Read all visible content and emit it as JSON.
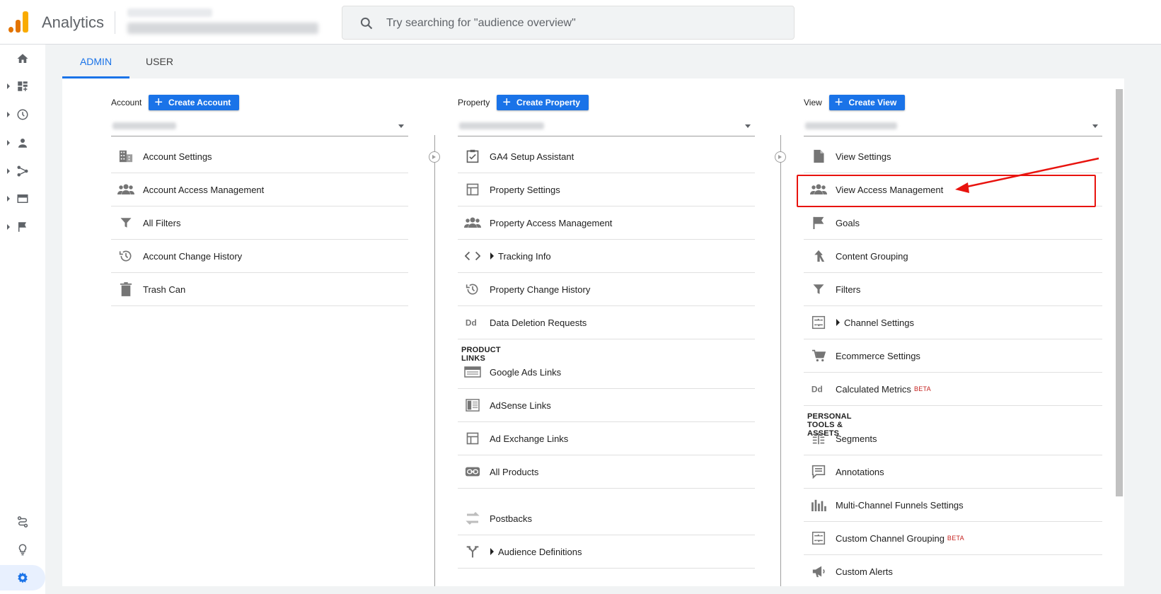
{
  "app": {
    "title": "Analytics"
  },
  "search": {
    "placeholder": "Try searching for \"audience overview\""
  },
  "tabs": [
    {
      "label": "ADMIN"
    },
    {
      "label": "USER"
    }
  ],
  "account": {
    "label": "Account",
    "create_label": "Create Account",
    "items": [
      {
        "label": "Account Settings",
        "icon": "building-icon"
      },
      {
        "label": "Account Access Management",
        "icon": "people-icon"
      },
      {
        "label": "All Filters",
        "icon": "filter-icon"
      },
      {
        "label": "Account Change History",
        "icon": "history-icon"
      },
      {
        "label": "Trash Can",
        "icon": "trash-icon"
      }
    ]
  },
  "property": {
    "label": "Property",
    "create_label": "Create Property",
    "items": [
      {
        "label": "GA4 Setup Assistant",
        "icon": "clipboard-check-icon"
      },
      {
        "label": "Property Settings",
        "icon": "layout-icon"
      },
      {
        "label": "Property Access Management",
        "icon": "people-icon"
      },
      {
        "label": "Tracking Info",
        "icon": "code-icon"
      },
      {
        "label": "Property Change History",
        "icon": "history-icon"
      },
      {
        "label": "Data Deletion Requests",
        "icon": "dd-icon"
      }
    ],
    "section_title": "PRODUCT LINKS",
    "links": [
      {
        "label": "Google Ads Links",
        "icon": "ads-icon"
      },
      {
        "label": "AdSense Links",
        "icon": "adsense-icon"
      },
      {
        "label": "Ad Exchange Links",
        "icon": "layout-icon"
      },
      {
        "label": "All Products",
        "icon": "link-icon"
      },
      {
        "label": "Postbacks",
        "icon": "postbacks-icon"
      },
      {
        "label": "Audience Definitions",
        "icon": "fork-icon"
      }
    ]
  },
  "view": {
    "label": "View",
    "create_label": "Create View",
    "items": [
      {
        "label": "View Settings",
        "icon": "document-icon"
      },
      {
        "label": "View Access Management",
        "icon": "people-icon"
      },
      {
        "label": "Goals",
        "icon": "flag-icon"
      },
      {
        "label": "Content Grouping",
        "icon": "grouping-icon"
      },
      {
        "label": "Filters",
        "icon": "filter-icon"
      },
      {
        "label": "Channel Settings",
        "icon": "channel-icon"
      },
      {
        "label": "Ecommerce Settings",
        "icon": "cart-icon"
      },
      {
        "label": "Calculated Metrics",
        "icon": "dd-icon",
        "badge": "BETA"
      }
    ],
    "section_title": "PERSONAL TOOLS & ASSETS",
    "tools": [
      {
        "label": "Segments",
        "icon": "segments-icon"
      },
      {
        "label": "Annotations",
        "icon": "annotation-icon"
      },
      {
        "label": "Multi-Channel Funnels Settings",
        "icon": "bars-icon"
      },
      {
        "label": "Custom Channel Grouping",
        "icon": "channel-icon",
        "badge": "BETA"
      },
      {
        "label": "Custom Alerts",
        "icon": "megaphone-icon"
      }
    ]
  },
  "colors": {
    "accent": "#1a73e8",
    "highlight": "#e8130e",
    "icon": "#5f6368"
  }
}
